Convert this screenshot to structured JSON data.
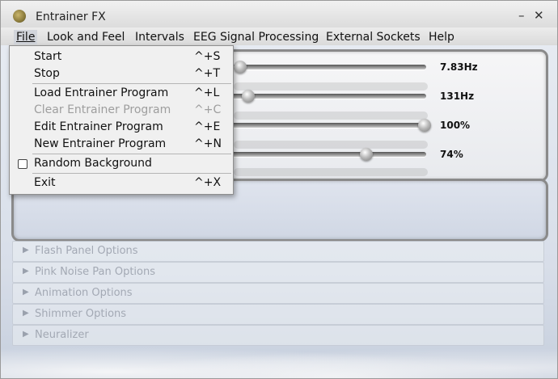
{
  "window": {
    "title": "Entrainer FX",
    "minimize_glyph": "–",
    "close_glyph": "✕"
  },
  "menubar": {
    "file": "File",
    "look_and_feel": "Look and Feel",
    "intervals": "Intervals",
    "eeg": "EEG Signal Processing",
    "external_sockets": "External Sockets",
    "help": "Help"
  },
  "file_menu": {
    "items": [
      {
        "label": "Start",
        "shortcut": "^+S",
        "enabled": true
      },
      {
        "label": "Stop",
        "shortcut": "^+T",
        "enabled": true
      },
      {
        "label": "Load Entrainer Program",
        "shortcut": "^+L",
        "enabled": true
      },
      {
        "label": "Clear Entrainer Program",
        "shortcut": "^+C",
        "enabled": false
      },
      {
        "label": "Edit Entrainer Program",
        "shortcut": "^+E",
        "enabled": true
      },
      {
        "label": "New Entrainer Program",
        "shortcut": "^+N",
        "enabled": true
      },
      {
        "label": "Random Background",
        "shortcut": "",
        "enabled": true,
        "checked": false
      },
      {
        "label": "Exit",
        "shortcut": "^+X",
        "enabled": true
      }
    ]
  },
  "sliders": [
    {
      "value_label": "7.83Hz"
    },
    {
      "value_label": "131Hz"
    },
    {
      "value_label": "100%"
    },
    {
      "value_label": "74%"
    }
  ],
  "options": [
    {
      "label": "Flash Panel Options"
    },
    {
      "label": "Pink Noise Pan Options"
    },
    {
      "label": "Animation Options"
    },
    {
      "label": "Shimmer Options"
    },
    {
      "label": "Neuralizer"
    }
  ]
}
